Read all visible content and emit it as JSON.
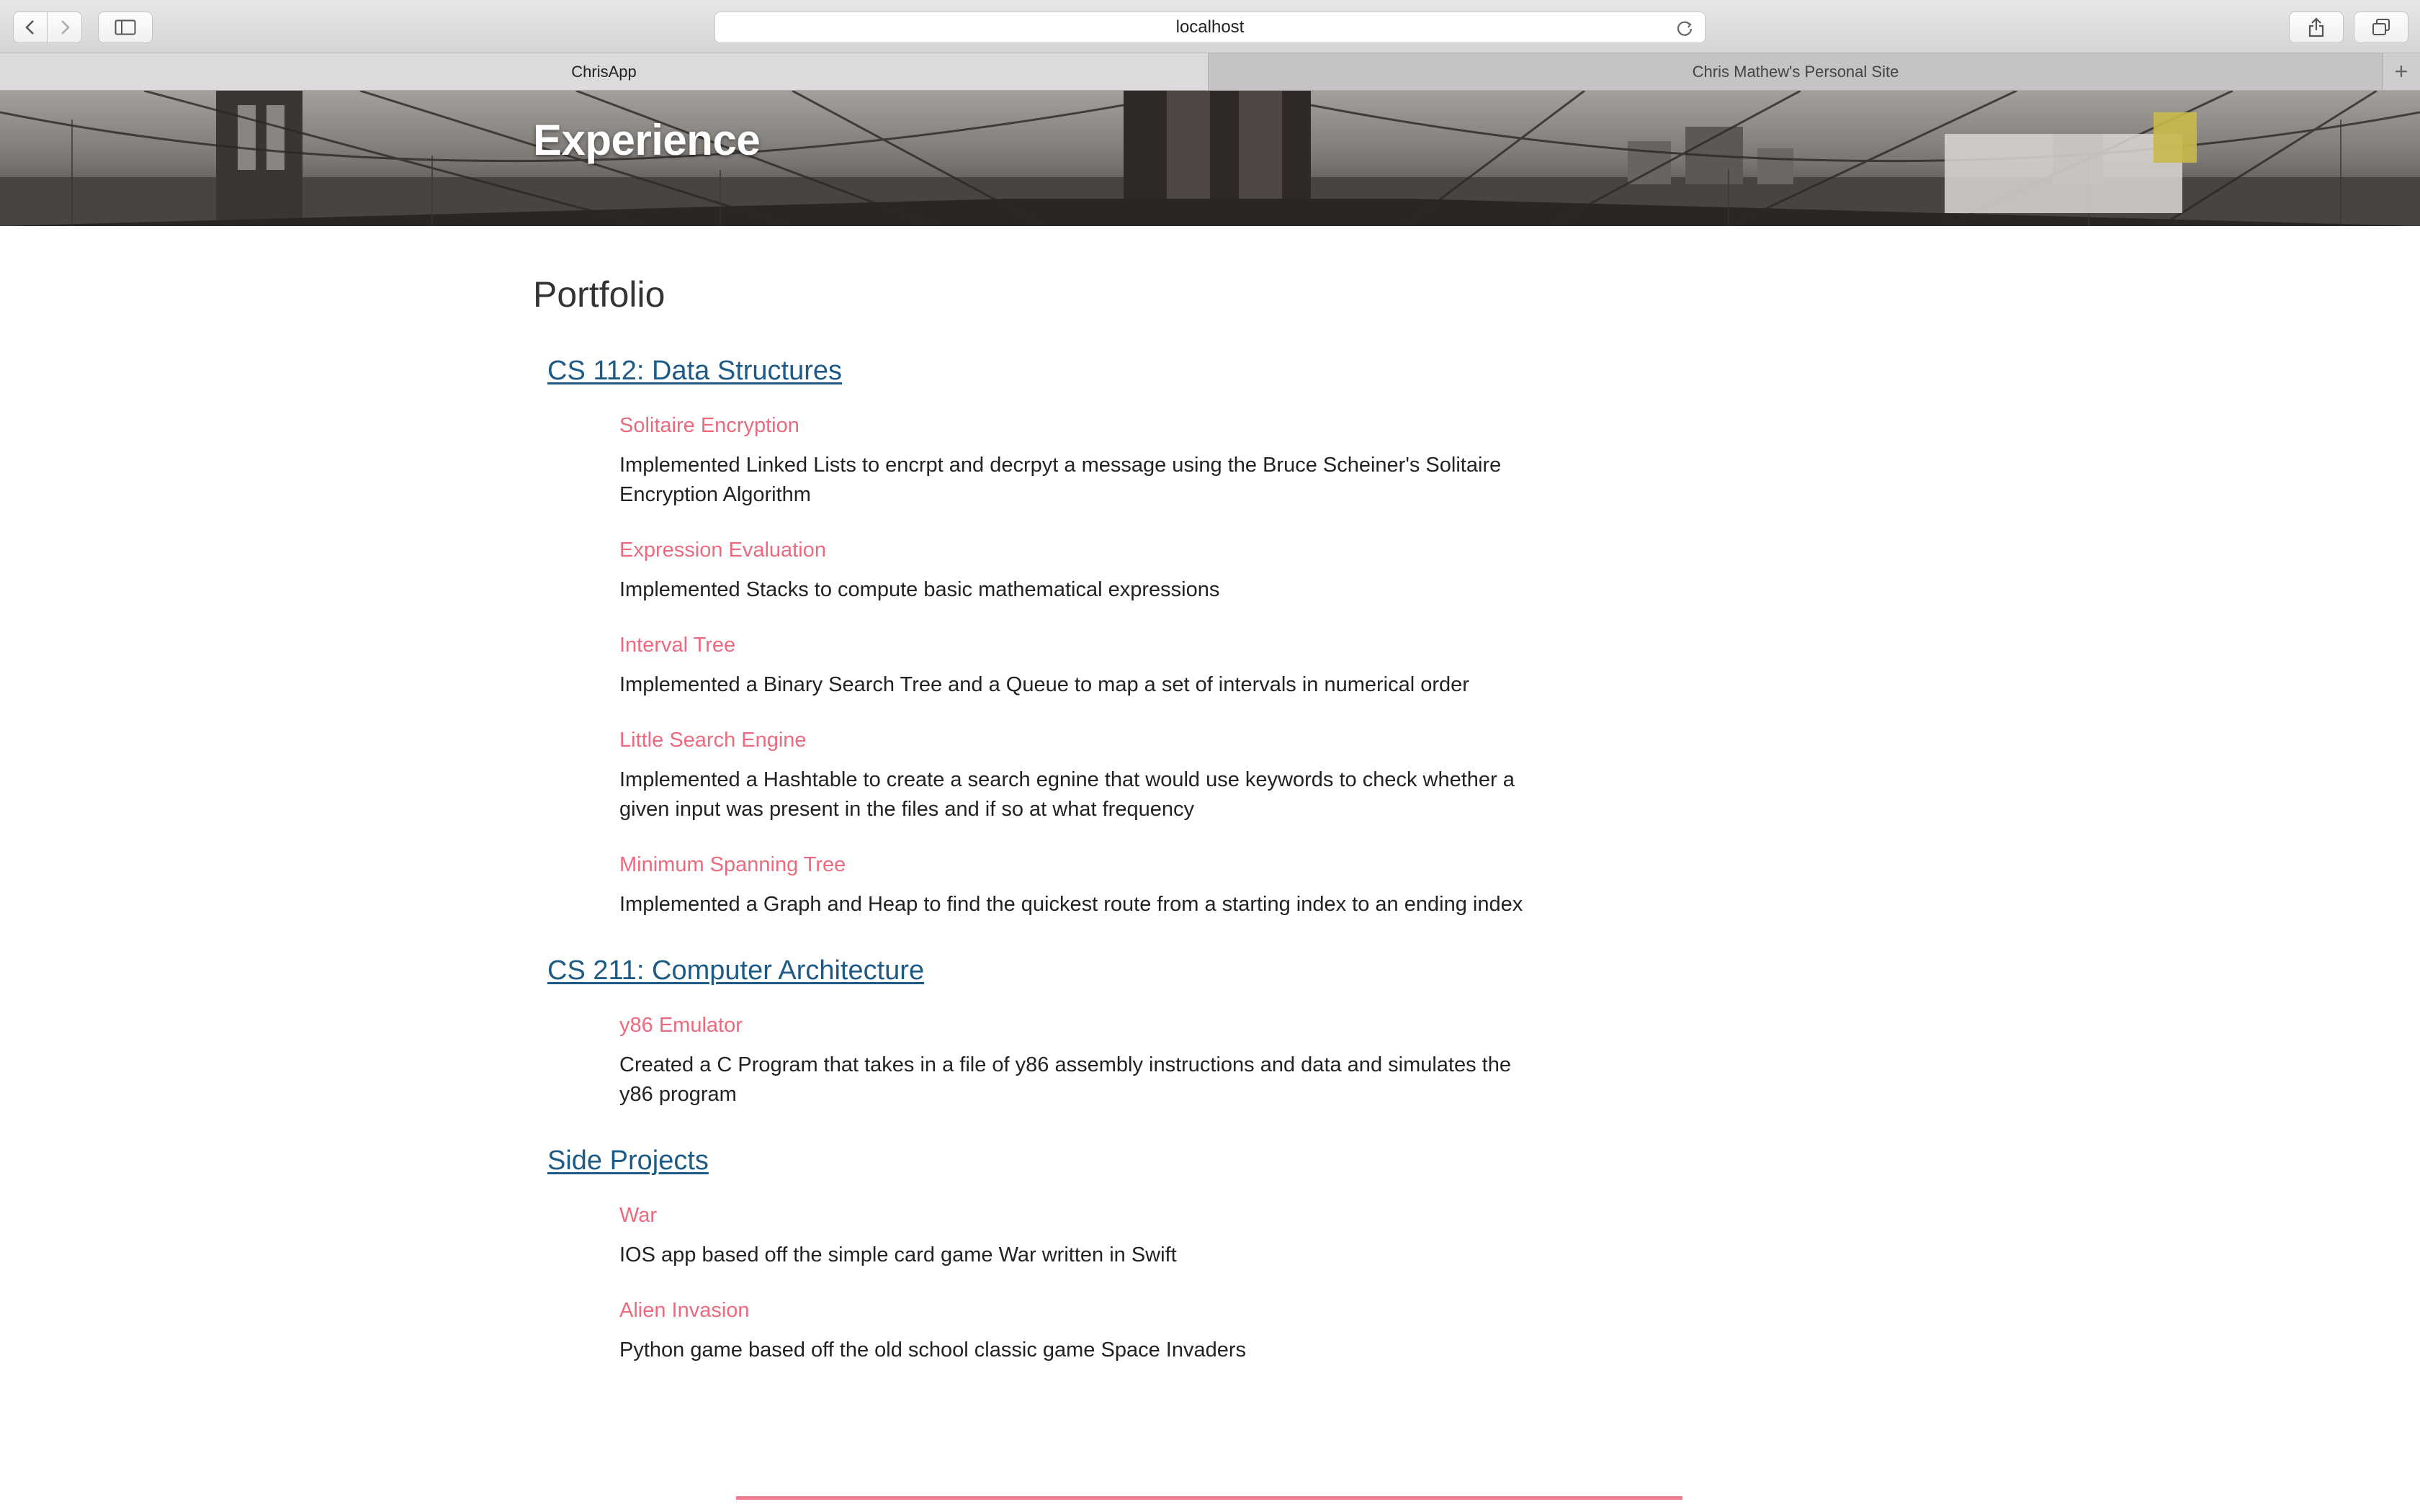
{
  "browser": {
    "address": "localhost",
    "tabs": [
      {
        "label": "ChrisApp",
        "active": true
      },
      {
        "label": "Chris Mathew's Personal Site",
        "active": false
      }
    ],
    "new_tab_symbol": "+",
    "icons": [
      "back-icon",
      "forward-icon",
      "sidebar-icon",
      "reload-icon",
      "share-icon",
      "tabs-overview-icon"
    ]
  },
  "hero": {
    "title": "Experience"
  },
  "main": {
    "heading": "Portfolio",
    "courses": [
      {
        "title": "CS 112: Data Structures",
        "projects": [
          {
            "title": "Solitaire Encryption",
            "description": "Implemented Linked Lists to encrpt and decrpyt a message using the Bruce Scheiner's Solitaire Encryption Algorithm"
          },
          {
            "title": "Expression Evaluation",
            "description": "Implemented Stacks to compute basic mathematical expressions"
          },
          {
            "title": "Interval Tree",
            "description": "Implemented a Binary Search Tree and a Queue to map a set of intervals in numerical order"
          },
          {
            "title": "Little Search Engine",
            "description": "Implemented a Hashtable to create a search egnine that would use keywords to check whether a given input was present in the files and if so at what frequency"
          },
          {
            "title": "Minimum Spanning Tree",
            "description": "Implemented a Graph and Heap to find the quickest route from a starting index to an ending index"
          }
        ]
      },
      {
        "title": "CS 211: Computer Architecture",
        "projects": [
          {
            "title": "y86 Emulator",
            "description": "Created a C Program that takes in a file of y86 assembly instructions and data and simulates the y86 program"
          }
        ]
      },
      {
        "title": "Side Projects",
        "projects": [
          {
            "title": "War",
            "description": "IOS app based off the simple card game War written in Swift"
          },
          {
            "title": "Alien Invasion",
            "description": "Python game based off the old school classic game Space Invaders"
          }
        ]
      }
    ]
  },
  "colors": {
    "link": "#1e5a86",
    "project_title": "#ed6a7e",
    "footer_rule": "#ee7b8e"
  }
}
